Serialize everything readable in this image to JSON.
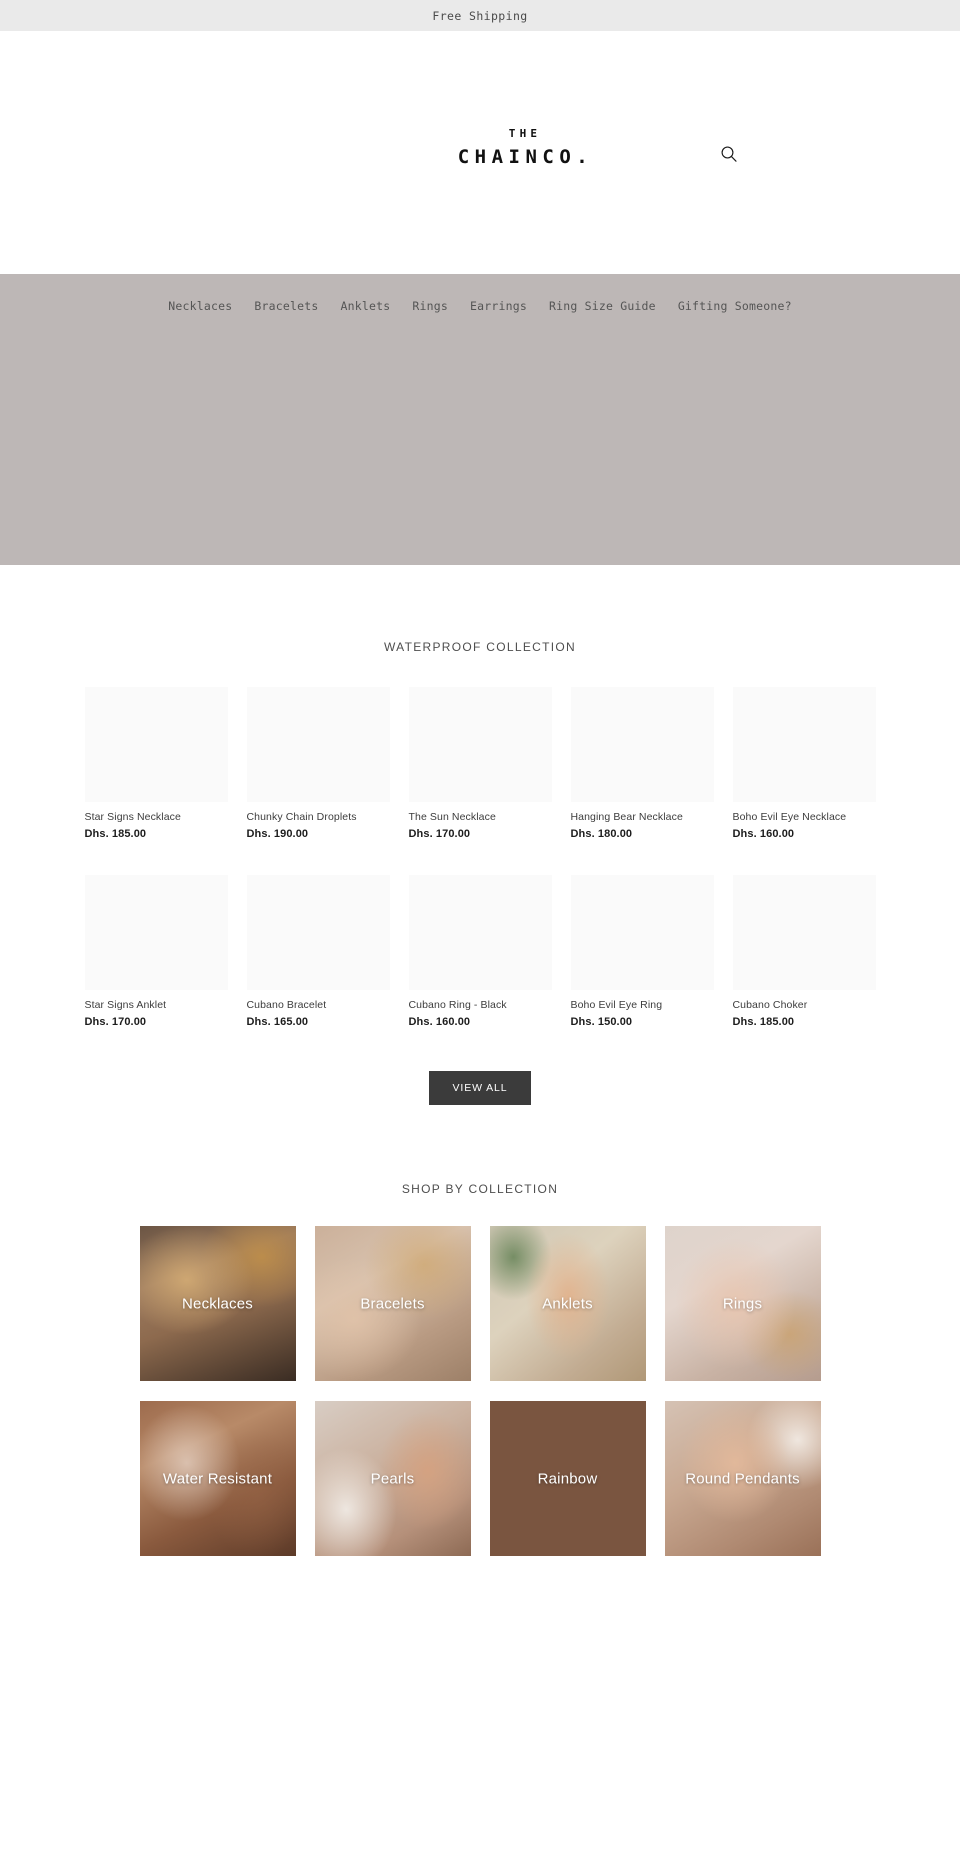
{
  "announcement": {
    "text": "Free Shipping"
  },
  "header": {
    "logo_top": "THE",
    "logo_name": "CHAINCO.",
    "search_icon": "search-icon"
  },
  "nav": {
    "items": [
      {
        "label": "Necklaces"
      },
      {
        "label": "Bracelets"
      },
      {
        "label": "Anklets"
      },
      {
        "label": "Rings"
      },
      {
        "label": "Earrings"
      },
      {
        "label": "Ring Size Guide"
      },
      {
        "label": "Gifting Someone?"
      }
    ]
  },
  "hero": {
    "background_color": "#bdb7b6"
  },
  "waterproof": {
    "title": "WATERPROOF COLLECTION",
    "view_all_label": "VIEW ALL",
    "products": [
      {
        "name": "Star Signs Necklace",
        "price": "Dhs. 185.00"
      },
      {
        "name": "Chunky Chain Droplets",
        "price": "Dhs. 190.00"
      },
      {
        "name": "The Sun Necklace",
        "price": "Dhs. 170.00"
      },
      {
        "name": "Hanging Bear Necklace",
        "price": "Dhs. 180.00"
      },
      {
        "name": "Boho Evil Eye Necklace",
        "price": "Dhs. 160.00"
      },
      {
        "name": "Star Signs Anklet",
        "price": "Dhs. 170.00"
      },
      {
        "name": "Cubano Bracelet",
        "price": "Dhs. 165.00"
      },
      {
        "name": "Cubano Ring - Black",
        "price": "Dhs. 160.00"
      },
      {
        "name": "Boho Evil Eye Ring",
        "price": "Dhs. 150.00"
      },
      {
        "name": "Cubano Choker",
        "price": "Dhs. 185.00"
      }
    ]
  },
  "shop_by_collection": {
    "title": "SHOP BY COLLECTION",
    "tiles": [
      {
        "label": "Necklaces"
      },
      {
        "label": "Bracelets"
      },
      {
        "label": "Anklets"
      },
      {
        "label": "Rings"
      },
      {
        "label": "Water Resistant"
      },
      {
        "label": "Pearls"
      },
      {
        "label": "Rainbow"
      },
      {
        "label": "Round Pendants"
      }
    ]
  },
  "colors": {
    "announcement_bg": "#eaeaea",
    "hero_bg": "#bdb7b6",
    "button_bg": "#3b3b3b",
    "product_thumb_bg": "#fafafa",
    "text_primary": "#1d1d1d",
    "text_muted": "#555555"
  }
}
